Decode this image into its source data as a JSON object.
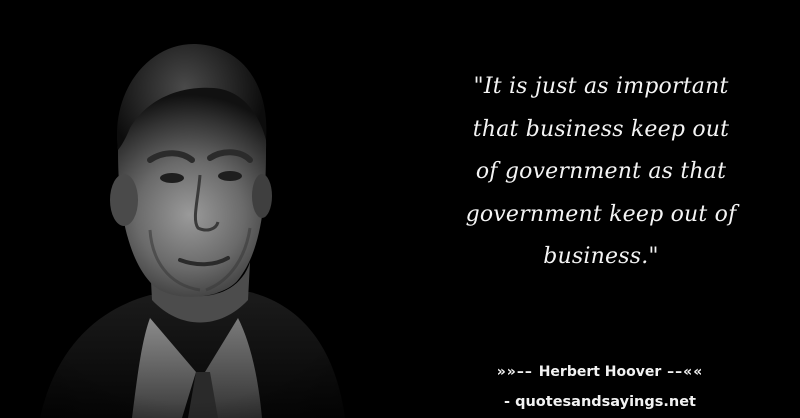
{
  "quote": {
    "lines": [
      "\"It is just as important",
      "that business keep out",
      "of government as that",
      "government keep out of",
      "business.\""
    ]
  },
  "attribution": {
    "prefix": "»»–– ",
    "author": "Herbert Hoover",
    "suffix": " ––««"
  },
  "source": {
    "text": "- quotesandsayings.net"
  },
  "colors": {
    "background": "#000000",
    "text": "#f4f4f4"
  },
  "image": {
    "subject_icon": "portrait-photo"
  }
}
